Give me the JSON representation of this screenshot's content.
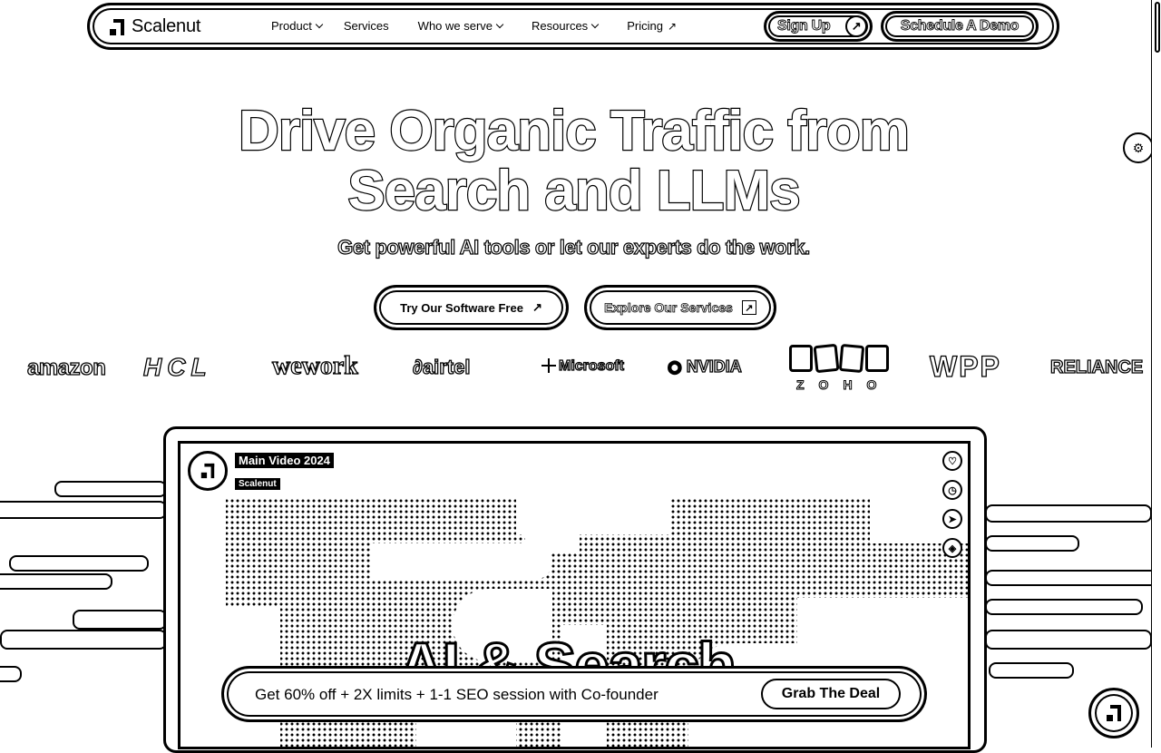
{
  "brand": {
    "name": "Scalenut"
  },
  "nav": {
    "items": [
      {
        "label": "Product",
        "has_dropdown": true
      },
      {
        "label": "Services",
        "has_dropdown": false
      },
      {
        "label": "Who we serve",
        "has_dropdown": true
      },
      {
        "label": "Resources",
        "has_dropdown": true
      },
      {
        "label": "Pricing",
        "has_dropdown": false,
        "external": true
      }
    ],
    "signup_label": "Sign Up",
    "demo_label": "Schedule A Demo"
  },
  "hero": {
    "title_line1": "Drive Organic Traffic from",
    "title_line2": "Search and LLMs",
    "subtitle": "Get powerful AI tools or let our experts do the work.",
    "cta_software": "Try Our Software Free",
    "cta_services": "Explore Our Services"
  },
  "logos": [
    "amazon",
    "HCL",
    "wework",
    "airtel",
    "Microsoft",
    "NVIDIA",
    "ZOHO",
    "WPP",
    "RELIANCE"
  ],
  "video": {
    "title": "Main Video 2024",
    "channel": "Scalenut",
    "overlay_text": "AI & Search"
  },
  "promo": {
    "text": "Get 60% off + 2X limits + 1-1 SEO session with Co-founder",
    "button": "Grab The Deal"
  }
}
